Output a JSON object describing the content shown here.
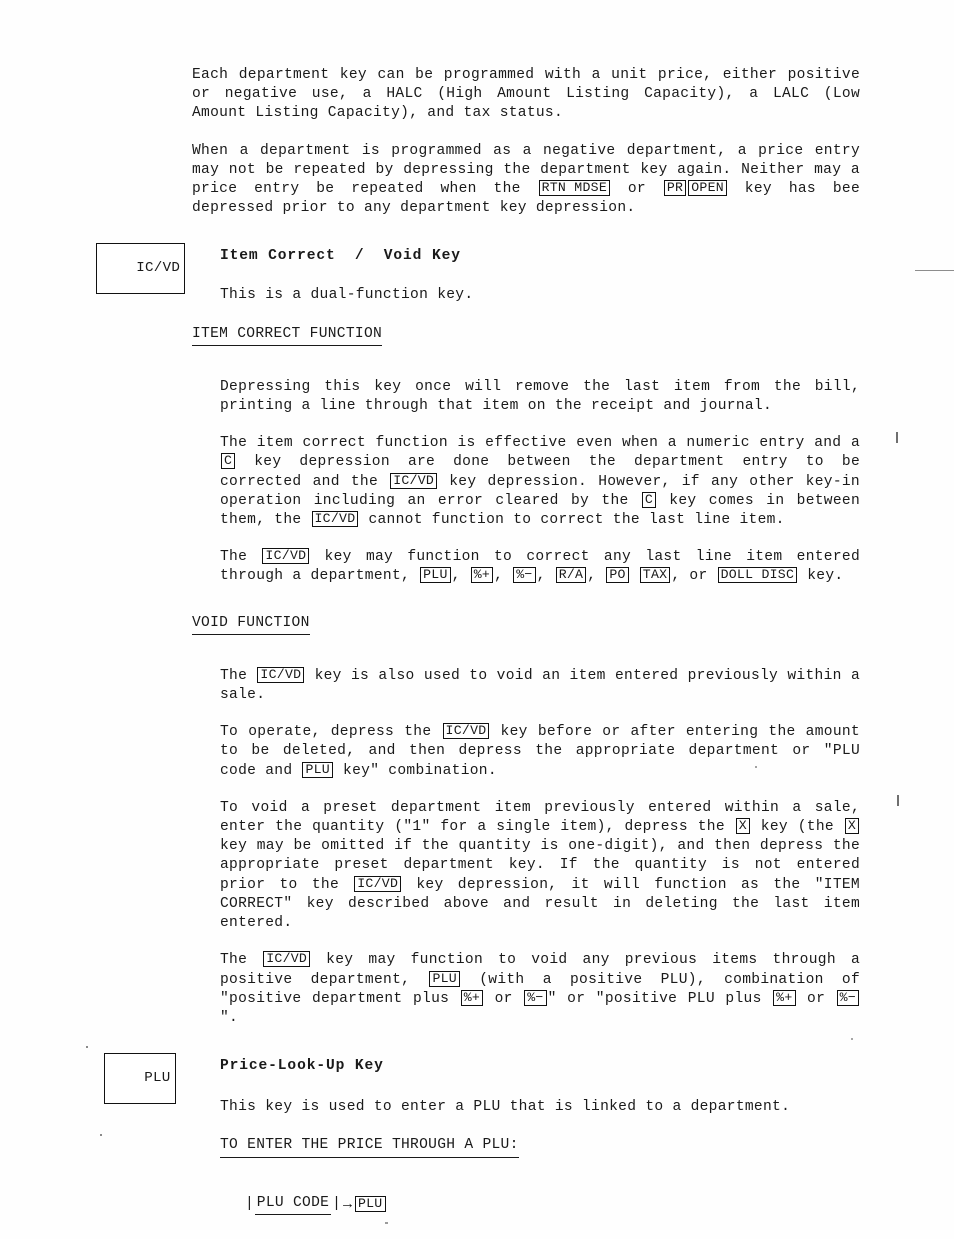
{
  "document": {
    "type": "scanned-manual-page",
    "intro": {
      "paragraphs": [
        "Each department key can be programmed with a unit price, either positive or negative use, a HALC (High Amount Listing Capacity), a LALC (Low Amount Listing Capacity), and tax status."
      ]
    },
    "sections": [
      {
        "id": "ic-vd",
        "gutter_key": "IC/VD",
        "title": "Item Correct  /  Void Key",
        "lead": "This is a dual-function key.",
        "subsections": [
          {
            "id": "item-correct-function",
            "heading": "ITEM CORRECT FUNCTION"
          },
          {
            "id": "void-function",
            "heading": "VOID FUNCTION"
          }
        ]
      },
      {
        "id": "plu",
        "gutter_key": "PLU",
        "title": "Price-Look-Up Key",
        "lead": "This key is used to enter a PLU that is linked to a department.",
        "subsections": [
          {
            "id": "enter-price-through-plu",
            "heading": "TO ENTER THE PRICE THROUGH A PLU:"
          }
        ]
      }
    ]
  },
  "intro": {
    "p1_a": "Each department key can be programmed with a unit price, either positive or negative use, a HALC (High Amount Listing Capacity), a LALC (Low Amount Listing Capacity), and tax status.",
    "p2_a": "When a department is programmed as a negative department, a price entry may not be repeated by depressing the department key again. Neither may a price entry be repeated when the ",
    "p2_b": " or ",
    "p2_c": " key has bee depressed prior to any department key depression."
  },
  "icvd": {
    "gutter_key": "IC/VD",
    "title": "Item Correct  /  Void Key",
    "lead": "This is a dual-function key.",
    "item_correct_heading": "ITEM CORRECT FUNCTION",
    "ic_p1": "Depressing this key once will remove the last item from the bill, printing a line through that item on the receipt and journal.",
    "ic_p2_a": "The item correct function is effective even when a numeric entry and a ",
    "ic_p2_b": " key depression are done between the department entry to be corrected and the ",
    "ic_p2_c": " key depression.  However, if any other key-in operation including an error cleared by the ",
    "ic_p2_d": " key comes in between them, the ",
    "ic_p2_e": " cannot function to correct the last line item.",
    "ic_p3_a": "The ",
    "ic_p3_b": " key may function to correct any last line item entered through a department, ",
    "ic_p3_c": ", ",
    "ic_p3_d": ", ",
    "ic_p3_e": ", ",
    "ic_p3_f": ", ",
    "ic_p3_g": "  ",
    "ic_p3_h": ", or ",
    "ic_p3_i": " key.",
    "void_heading": "VOID FUNCTION",
    "vd_p1_a": "The ",
    "vd_p1_b": " key is also used to void an item entered previously within  a sale.",
    "vd_p2_a": "To operate, depress the ",
    "vd_p2_b": " key before or after entering the amount to be deleted, and then depress the appropriate department or \"PLU code and ",
    "vd_p2_c": " key\" combination.",
    "vd_p3_a": "To void a preset department item previously entered within a sale, enter the quantity (\"1\" for a single item), depress the ",
    "vd_p3_b": " key (the ",
    "vd_p3_c": " key may be omitted if the quantity is one-digit), and then depress the appropriate preset department key.  If the quantity is not entered prior to the ",
    "vd_p3_d": " key depression, it will function as the \"ITEM CORRECT\" key described above and result in deleting the last item entered.",
    "vd_p4_a": "The ",
    "vd_p4_b": " key may function to void any previous items through a positive department, ",
    "vd_p4_c": " (with a positive PLU), combination of \"positive department plus ",
    "vd_p4_d": " or ",
    "vd_p4_e": "\" or \"positive PLU plus ",
    "vd_p4_f": " or ",
    "vd_p4_g": "\"."
  },
  "plu_section": {
    "gutter_key": "PLU",
    "title": "Price-Look-Up Key",
    "lead": "This key is used to enter a PLU that is linked to a department.",
    "subhead": "TO ENTER THE PRICE THROUGH A PLU:",
    "flow": {
      "pipe_left": "|",
      "code_label": "PLU CODE",
      "pipe_right": "|",
      "arrow": "→",
      "target_key": "PLU"
    }
  },
  "keys": {
    "rtn_mdse": "RTN MDSE",
    "pr": "PR",
    "open": "OPEN",
    "icvd": "IC/VD",
    "c": "C",
    "plu": "PLU",
    "pct_plus": "%+",
    "pct_minus": "%−",
    "ra": "R/A",
    "po": "PO",
    "tax": "TAX",
    "doll_disc": "DOLL DISC",
    "x": "X"
  }
}
